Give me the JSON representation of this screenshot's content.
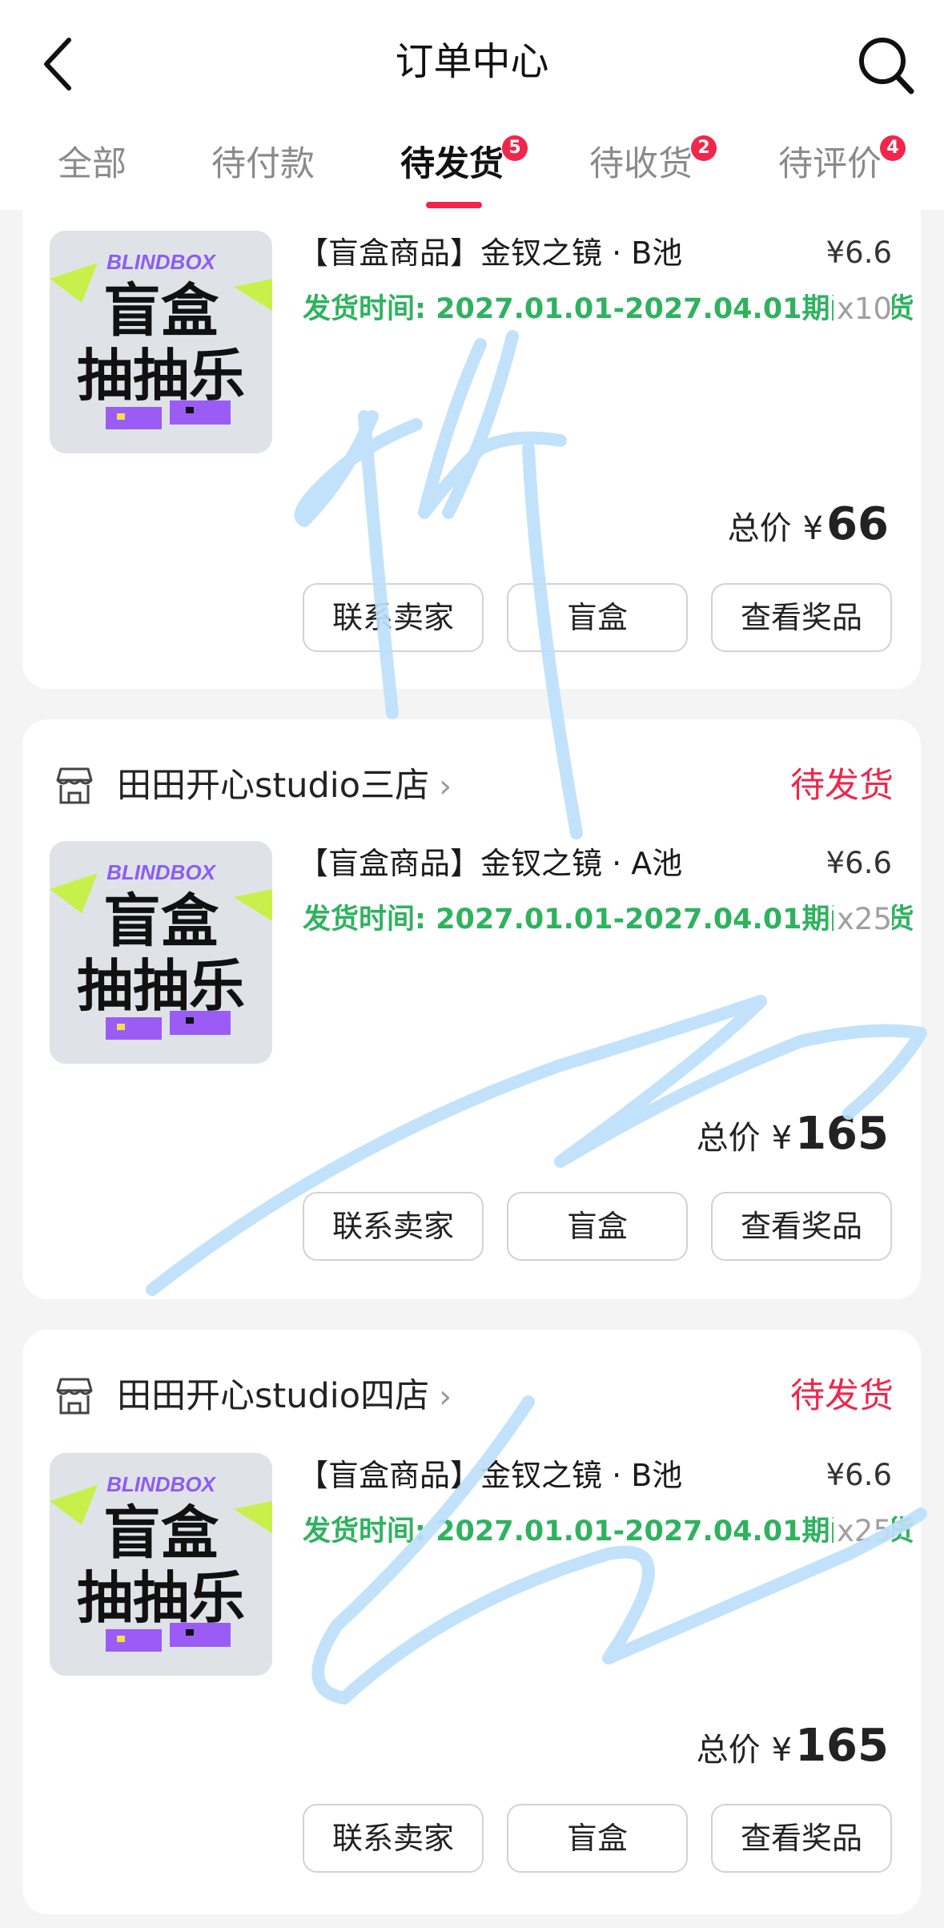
{
  "header": {
    "title": "订单中心"
  },
  "tabs": [
    {
      "label": "全部",
      "badge": ""
    },
    {
      "label": "待付款",
      "badge": ""
    },
    {
      "label": "待发货",
      "badge": "5"
    },
    {
      "label": "待收货",
      "badge": "2"
    },
    {
      "label": "待评价",
      "badge": "4"
    }
  ],
  "thumbnail": {
    "brand": "BLINDBOX",
    "line1": "盲盒",
    "line2": "抽抽乐"
  },
  "orders": [
    {
      "product_name": "【盲盒商品】金钗之镜 · B池",
      "price": "¥6.6",
      "ship_time": "发货时间: 2027.01.01-2027.04.01期间发货",
      "qty": "x10",
      "total_label": "总价",
      "total_currency": "¥",
      "total_amount": "66",
      "buttons": [
        "联系卖家",
        "盲盒",
        "查看奖品"
      ]
    },
    {
      "shop_name": "田田开心studio三店",
      "status": "待发货",
      "product_name": "【盲盒商品】金钗之镜 · A池",
      "price": "¥6.6",
      "ship_time": "发货时间: 2027.01.01-2027.04.01期间发货",
      "qty": "x25",
      "total_label": "总价",
      "total_currency": "¥",
      "total_amount": "165",
      "buttons": [
        "联系卖家",
        "盲盒",
        "查看奖品"
      ]
    },
    {
      "shop_name": "田田开心studio四店",
      "status": "待发货",
      "product_name": "【盲盒商品】金钗之镜 · B池",
      "price": "¥6.6",
      "ship_time": "发货时间: 2027.01.01-2027.04.01期间发货",
      "qty": "x25",
      "total_label": "总价",
      "total_currency": "¥",
      "total_amount": "165",
      "buttons": [
        "联系卖家",
        "盲盒",
        "查看奖品"
      ]
    }
  ],
  "colors": {
    "accent": "#f0264a",
    "ship_text": "#2fb25f",
    "scribble": "#bde0fb"
  }
}
